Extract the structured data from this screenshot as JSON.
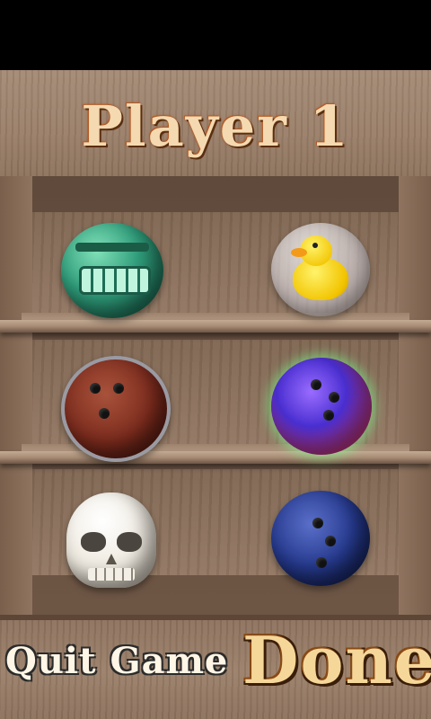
{
  "header": {
    "title": "Player 1"
  },
  "balls": [
    {
      "icon": "tiki-ball"
    },
    {
      "icon": "rubber-duck-ball"
    },
    {
      "icon": "lava-bowling-ball"
    },
    {
      "icon": "cosmic-bowling-ball"
    },
    {
      "icon": "skull-ball"
    },
    {
      "icon": "navy-bowling-ball"
    }
  ],
  "footer": {
    "quit_label": "Quit Game",
    "done_label": "Done"
  },
  "colors": {
    "title_text": "#f5d9b0",
    "done_text": "#f6d79a",
    "wood": "#9c806a"
  }
}
